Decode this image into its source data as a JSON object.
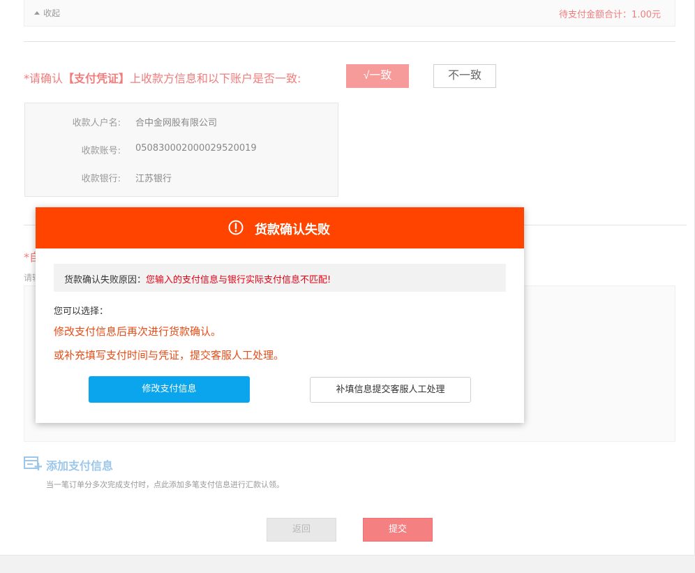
{
  "summary": {
    "collapse_label": "收起",
    "pending_total": "待支付金额合计：1.00元"
  },
  "confirm": {
    "prefix": "*请确认",
    "highlight": "【支付凭证】",
    "suffix": "上收款方信息和以下账户是否一致:",
    "match_label": "√一致",
    "mismatch_label": "不一致"
  },
  "payee": {
    "rows": [
      {
        "label": "收款人户名:",
        "value": "合中金网股有限公司"
      },
      {
        "label": "收款账号:",
        "value": "05083000200002952001​9"
      },
      {
        "label": "收款银行:",
        "value": "江苏银行"
      }
    ]
  },
  "background": {
    "section_label_partial": "*自",
    "hint_partial": "请输"
  },
  "add_payment": {
    "label": "添加支付信息",
    "desc": "当一笔订单分多次完成支付时，点此添加多笔支付信息进行汇款认领。"
  },
  "footer": {
    "back_label": "返回",
    "submit_label": "提交"
  },
  "modal": {
    "title": "货款确认失败",
    "reason_label": "货款确认失败原因：",
    "reason_value": "您输入的支付信息与银行实际支付信息不匹配!",
    "choose_label": "您可以选择：",
    "option_1": "修改支付信息后再次进行货款确认。",
    "option_2": "或补充填写支付时间与凭证，提交客服人工处理。",
    "modify_button": "修改支付信息",
    "manual_button": "补填信息提交客服人工处理"
  },
  "colors": {
    "header": "#ff4400",
    "primary_blue": "#0aa5ec",
    "accent_pink": "#f27c7c",
    "error_red": "#e60012",
    "option_orange": "#e84b16"
  },
  "icons": [
    "chevron-up-icon",
    "warning-circle-icon",
    "add-form-icon"
  ]
}
